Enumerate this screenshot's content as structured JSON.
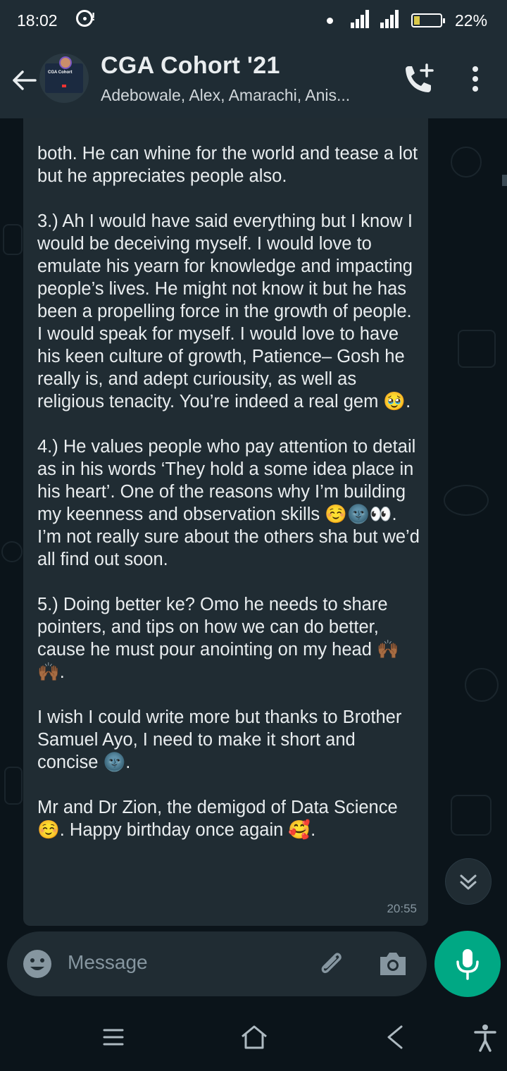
{
  "status_bar": {
    "time": "18:02",
    "notification_mark": "!",
    "battery_percent": "22%",
    "battery_level": 0.22
  },
  "header": {
    "title": "CGA Cohort '21",
    "subtitle": "Adebowale, Alex, Amarachi, Anis...",
    "avatar_text": "CGA Cohort"
  },
  "message": {
    "paragraphs": [
      "both. He can whine for the world and tease a lot but he appreciates people also.",
      "3.) Ah I would have said everything but I know I would be deceiving myself. I would love to emulate his yearn for knowledge and impacting people’s lives. He might not know it but he has been a propelling force in the growth of people. I would speak for myself. I would love to have his keen culture of growth, Patience– Gosh he really is, and adept curiousity, as well as religious tenacity. You’re indeed a real gem 🥹.",
      "4.) He values people who pay attention to detail as in his words ‘They hold a some idea place in his heart’. One of the reasons why I’m building my keenness and observation skills ☺️🌚👀. I’m not really sure about the others sha but we’d all find out soon.",
      "5.) Doing better ke? Omo he needs to share pointers, and tips on how we can do better, cause he must pour anointing on my head 🙌🏾🙌🏾.",
      "I wish I could write more but thanks to Brother Samuel Ayo, I need to make it short and concise 🌚.",
      "Mr and Dr Zion, the demigod of Data Science☺️. Happy birthday once again 🥰."
    ],
    "time": "20:55"
  },
  "composer": {
    "placeholder": "Message"
  },
  "colors": {
    "accent": "#00a884",
    "bubble": "#202c33",
    "background": "#0b141a",
    "header": "#1f2c34"
  }
}
